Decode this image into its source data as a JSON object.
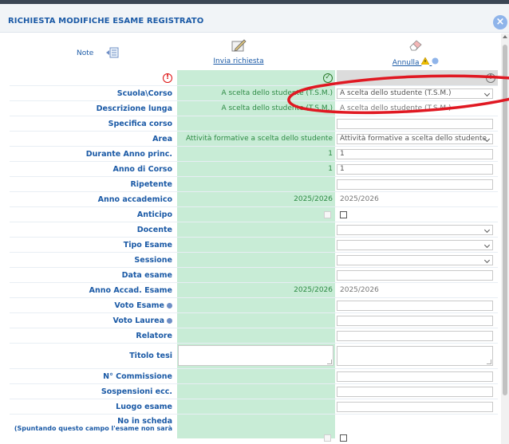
{
  "dialog": {
    "title": "RICHIESTA MODIFICHE ESAME REGISTRATO",
    "close_glyph": "×"
  },
  "toolbar": {
    "note_label": "Note",
    "send_label": "Invia richiesta",
    "cancel_label": "Annulla"
  },
  "rows": [
    {
      "label": "Scuola\\Corso",
      "old": "A scelta dello studente (T.S.M.)",
      "new": "A scelta dello studente (T.S.M.)"
    },
    {
      "label": "Descrizione lunga",
      "old": "A scelta dello studente (T.S.M.)",
      "new": "A scelta dello studente (T.S.M.)"
    },
    {
      "label": "Specifica corso",
      "old": "",
      "new": ""
    },
    {
      "label": "Area",
      "old": "Attività formative a scelta dello studente",
      "new": "Attività formative a scelta dello studente"
    },
    {
      "label": "Durante Anno princ.",
      "old": "1",
      "new": "1"
    },
    {
      "label": "Anno di Corso",
      "old": "1",
      "new": "1"
    },
    {
      "label": "Ripetente",
      "old": "",
      "new": ""
    },
    {
      "label": "Anno accademico",
      "old": "2025/2026",
      "new": "2025/2026"
    },
    {
      "label": "Anticipo",
      "old": "",
      "new": ""
    },
    {
      "label": "Docente",
      "old": "",
      "new": ""
    },
    {
      "label": "Tipo Esame",
      "old": "",
      "new": ""
    },
    {
      "label": "Sessione",
      "old": "",
      "new": ""
    },
    {
      "label": "Data esame",
      "old": "",
      "new": ""
    },
    {
      "label": "Anno Accad. Esame",
      "old": "2025/2026",
      "new": "2025/2026"
    },
    {
      "label": "Voto Esame",
      "old": "",
      "new": ""
    },
    {
      "label": "Voto Laurea",
      "old": "",
      "new": ""
    },
    {
      "label": "Relatore",
      "old": "",
      "new": ""
    },
    {
      "label": "Titolo tesi",
      "old": "",
      "new": ""
    },
    {
      "label": "N° Commissione",
      "old": "",
      "new": ""
    },
    {
      "label": "Sospensioni ecc.",
      "old": "",
      "new": ""
    },
    {
      "label": "Luogo esame",
      "old": "",
      "new": ""
    },
    {
      "label": "No in scheda",
      "old": "",
      "new": ""
    }
  ],
  "footer_note": "(Spuntando questo campo l'esame non sarà",
  "colors": {
    "accent": "#1b5aa6",
    "old_column": "#c8ecd6",
    "old_text": "#2e8b45",
    "annotation": "#e01822"
  }
}
